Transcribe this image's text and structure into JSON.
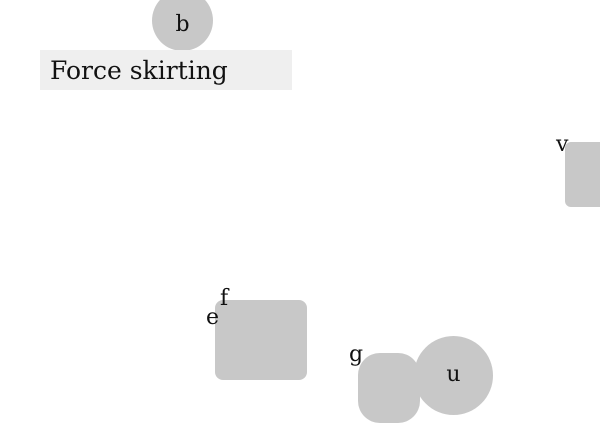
{
  "title_label": "Force skirting",
  "nodes": {
    "b": "b",
    "v": "v",
    "e": "e",
    "f": "f",
    "g": "g",
    "u": "u"
  },
  "colors": {
    "shape_fill": "#c8c8c8",
    "label_background": "#efefef",
    "text": "#111111",
    "background": "#ffffff"
  }
}
